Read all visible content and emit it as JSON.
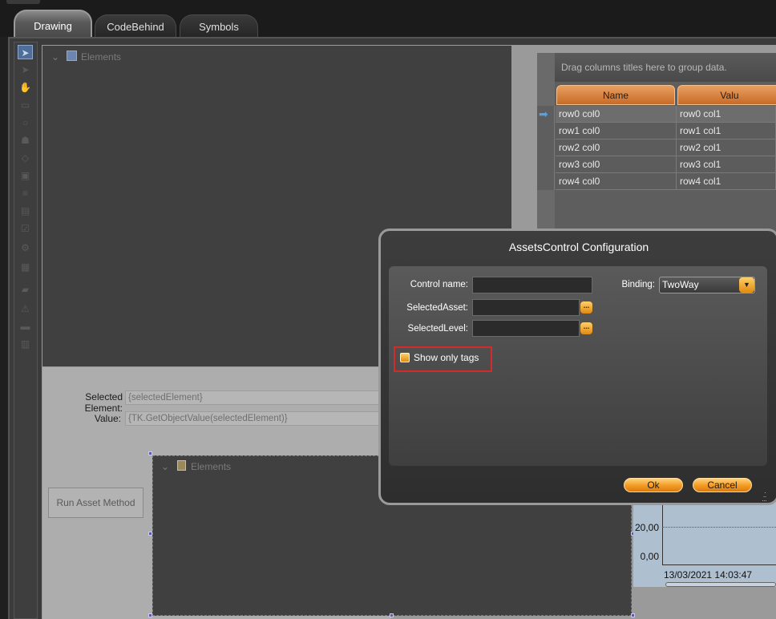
{
  "tabs": [
    {
      "label": "Drawing",
      "active": true
    },
    {
      "label": "CodeBehind",
      "active": false
    },
    {
      "label": "Symbols",
      "active": false
    }
  ],
  "toolbar_icons": [
    "pointer-icon",
    "pointer-alt-icon",
    "hand-icon",
    "rectangle-icon",
    "ellipse-icon",
    "polygon-icon",
    "diamond-icon",
    "button-tool-icon",
    "text-tool-icon",
    "textbox-tool-icon",
    "checkbox-tool-icon",
    "component-icon",
    "image-icon",
    "folder-icon",
    "bell-icon",
    "chart-icon",
    "grid-icon"
  ],
  "tree_top": {
    "label": "Elements"
  },
  "tree_bottom": {
    "label": "Elements"
  },
  "selected_element": {
    "label": "Selected Element:",
    "value": "{selectedElement}"
  },
  "value_row": {
    "label": "Value:",
    "value": "{TK.GetObjectValue(selectedElement)}"
  },
  "run_button": "Run Asset Method",
  "grid": {
    "group_hint": "Drag columns titles here to group data.",
    "columns": [
      "Name",
      "Valu"
    ],
    "rows": [
      [
        "row0 col0",
        "row0 col1"
      ],
      [
        "row1 col0",
        "row1 col1"
      ],
      [
        "row2 col0",
        "row2 col1"
      ],
      [
        "row3 col0",
        "row3 col1"
      ],
      [
        "row4 col0",
        "row4 col1"
      ]
    ]
  },
  "chart": {
    "yticks": [
      "20,00",
      "0,00"
    ],
    "xlabel": "13/03/2021 14:03:47"
  },
  "dialog": {
    "title": "AssetsControl Configuration",
    "control_name": {
      "label": "Control name:",
      "value": ""
    },
    "selected_asset": {
      "label": "SelectedAsset:",
      "value": ""
    },
    "selected_level": {
      "label": "SelectedLevel:",
      "value": ""
    },
    "binding": {
      "label": "Binding:",
      "value": "TwoWay"
    },
    "show_only_tags": {
      "label": "Show only tags",
      "checked": true
    },
    "browse_glyph": "...",
    "ok": "Ok",
    "cancel": "Cancel"
  }
}
